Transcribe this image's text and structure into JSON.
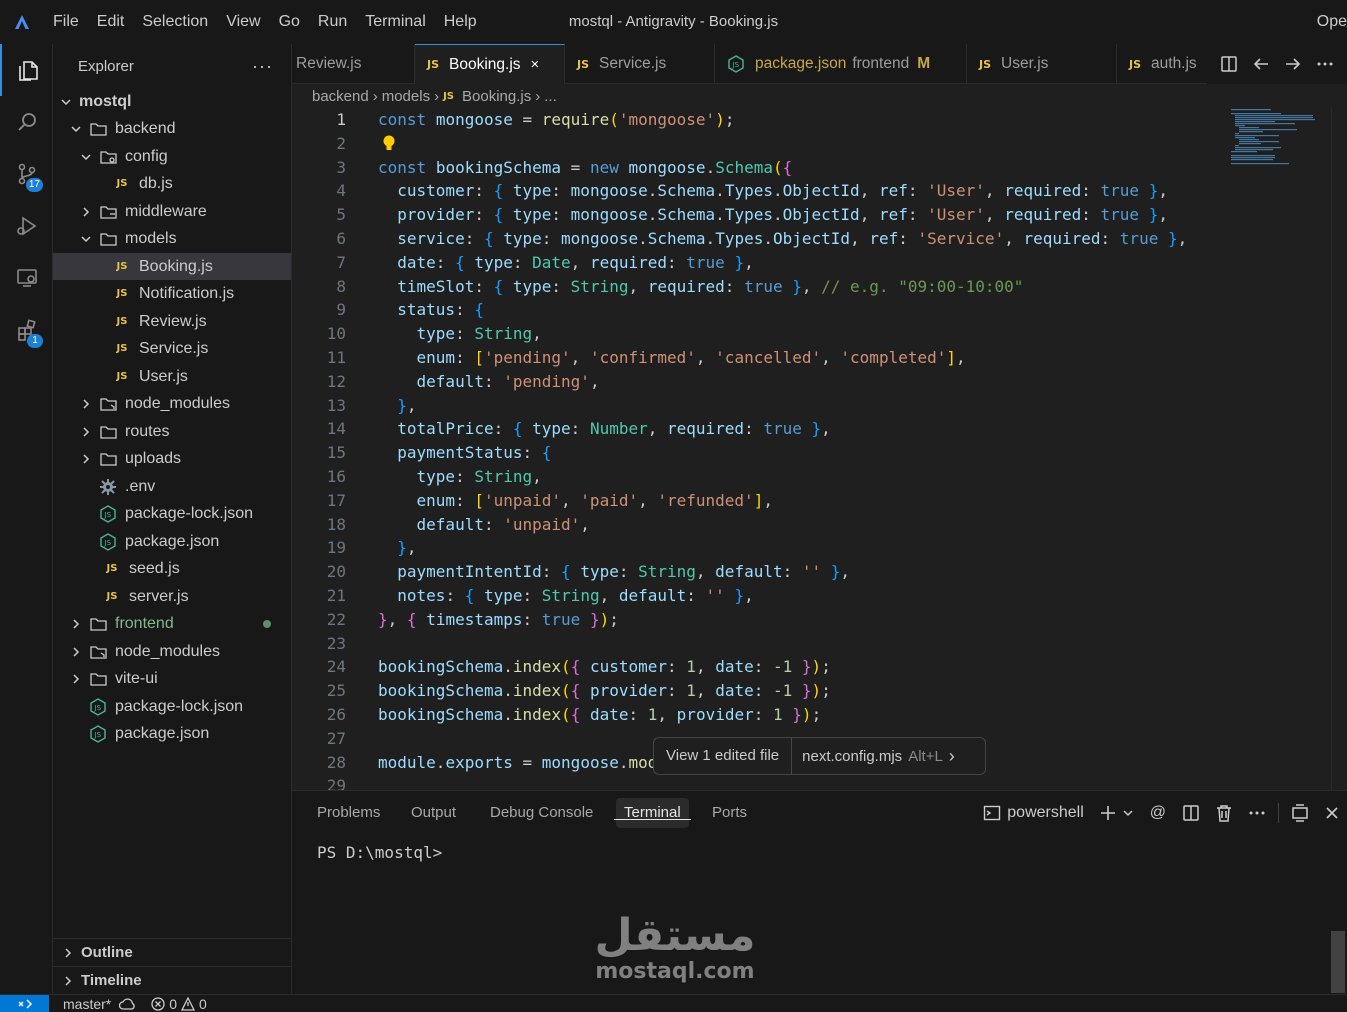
{
  "titlebar": {
    "menu": [
      "File",
      "Edit",
      "Selection",
      "View",
      "Go",
      "Run",
      "Terminal",
      "Help"
    ],
    "window_title": "mostql - Antigravity - Booking.js",
    "right_text": "Ope"
  },
  "activity": {
    "scm_badge": "17",
    "ext_badge": "1"
  },
  "sidebar": {
    "title": "Explorer",
    "more": "···",
    "tree": {
      "root": "mostql",
      "backend": "backend",
      "config": "config",
      "db": "db.js",
      "middleware": "middleware",
      "models": "models",
      "booking": "Booking.js",
      "notification": "Notification.js",
      "review": "Review.js",
      "service": "Service.js",
      "user": "User.js",
      "node_modules_b": "node_modules",
      "routes": "routes",
      "uploads": "uploads",
      "env": ".env",
      "pkglock_b": "package-lock.json",
      "pkg_b": "package.json",
      "seed": "seed.js",
      "server": "server.js",
      "frontend": "frontend",
      "node_modules": "node_modules",
      "viteui": "vite-ui",
      "pkglock": "package-lock.json",
      "pkg": "package.json"
    },
    "outline": "Outline",
    "timeline": "Timeline",
    "js_label": "JS"
  },
  "tabs": [
    {
      "label": "Review.js"
    },
    {
      "label": "Booking.js",
      "close": "×"
    },
    {
      "label": "Service.js"
    },
    {
      "label": "package.json",
      "desc": "frontend",
      "mod": "M"
    },
    {
      "label": "User.js"
    },
    {
      "label": "auth.js"
    }
  ],
  "breadcrumb": [
    "backend",
    "models",
    "Booking.js",
    "..."
  ],
  "editor": {
    "current_line": 1
  },
  "popup": {
    "view_edited": "View 1 edited file",
    "next_file": "next.config.mjs",
    "shortcut": "Alt+L",
    "chevron": "›"
  },
  "panel": {
    "tabs": [
      "Problems",
      "Output",
      "Debug Console",
      "Terminal",
      "Ports"
    ],
    "shell": "powershell",
    "prompt": "PS D:\\mostql>"
  },
  "watermark": {
    "arabic": "مستقل",
    "latin": "mostaql.com"
  },
  "statusbar": {
    "branch": "master*",
    "errors": "0",
    "warnings": "0"
  },
  "colors": {
    "accent": "#0078d4",
    "js_icon": "#e8c34a",
    "modified": "#c9a64a",
    "git_added": "#81b88b"
  }
}
